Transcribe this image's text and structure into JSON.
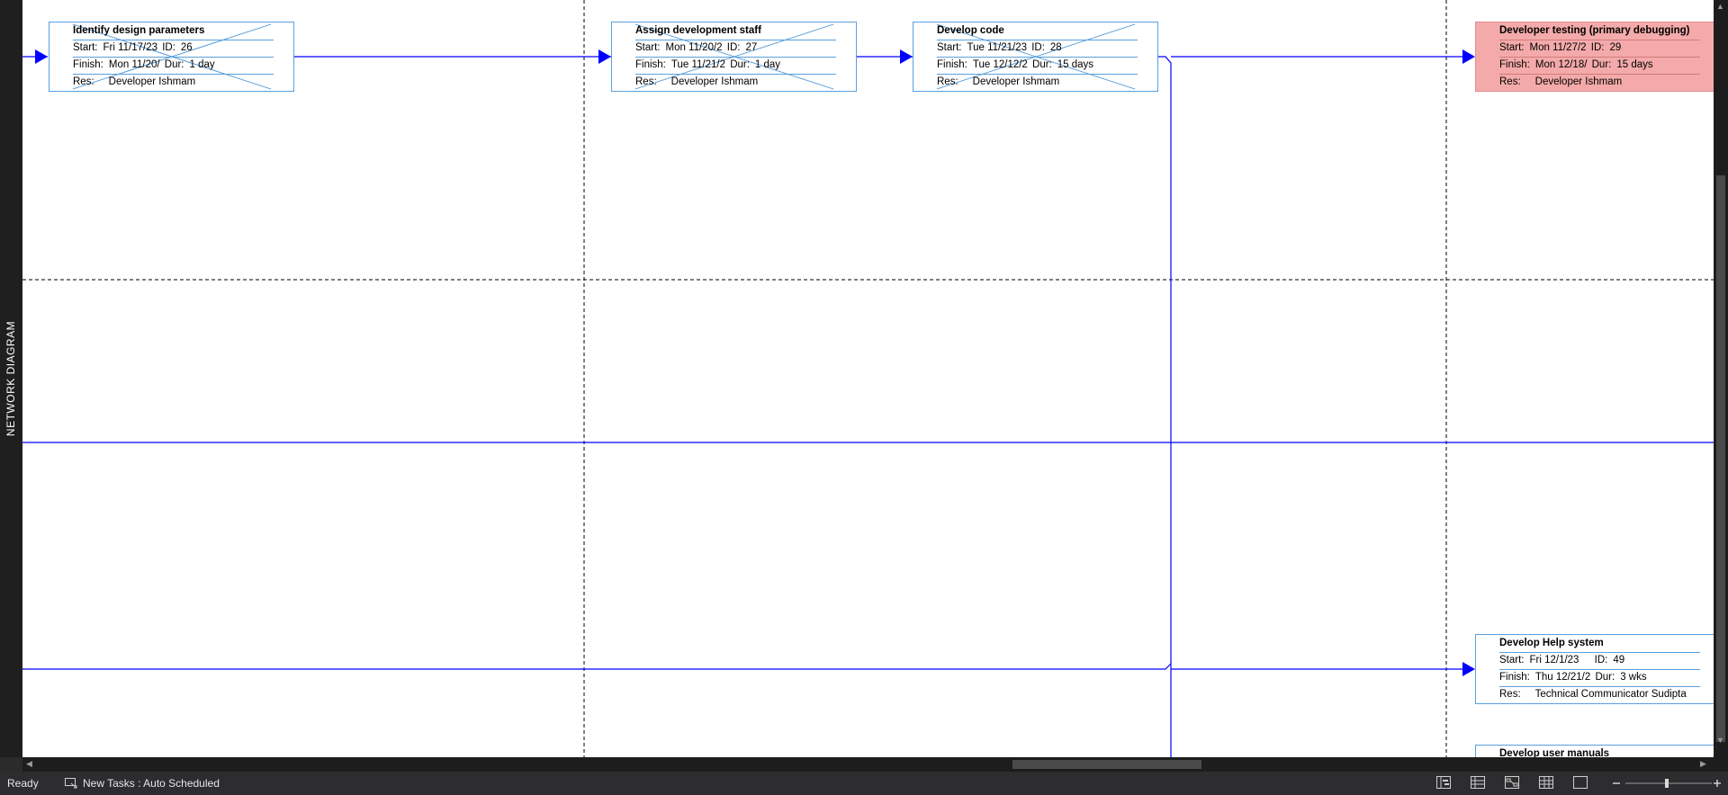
{
  "side_label": "NETWORK DIAGRAM",
  "labels": {
    "start": "Start:",
    "finish": "Finish:",
    "id": "ID:",
    "dur": "Dur:",
    "res": "Res:"
  },
  "tasks": [
    {
      "name": "Identify design parameters",
      "start": "Fri 11/17/23",
      "id": "26",
      "finish": "Mon 11/20/",
      "dur": "1 day",
      "res": "Developer Ishmam",
      "completed": true,
      "critical": false
    },
    {
      "name": "Assign development staff",
      "start": "Mon 11/20/2",
      "id": "27",
      "finish": "Tue 11/21/2",
      "dur": "1 day",
      "res": "Developer Ishmam",
      "completed": true,
      "critical": false
    },
    {
      "name": "Develop code",
      "start": "Tue 11/21/23",
      "id": "28",
      "finish": "Tue 12/12/2",
      "dur": "15 days",
      "res": "Developer Ishmam",
      "completed": true,
      "critical": false
    },
    {
      "name": "Developer testing (primary debugging)",
      "start": "Mon 11/27/2",
      "id": "29",
      "finish": "Mon 12/18/",
      "dur": "15 days",
      "res": "Developer Ishmam",
      "completed": false,
      "critical": true
    },
    {
      "name": "Develop Help system",
      "start": "Fri 12/1/23",
      "id": "49",
      "finish": "Thu 12/21/2",
      "dur": "3 wks",
      "res": "Technical Communicator Sudipta",
      "completed": false,
      "critical": false
    },
    {
      "name": "Develop user manuals",
      "completed": false,
      "critical": false
    }
  ],
  "status_bar": {
    "ready": "Ready",
    "new_tasks": "New Tasks : Auto Scheduled"
  },
  "colors": {
    "link": "#0000ff",
    "box_border": "#5aa0dc",
    "critical_fill": "#f4aaaa"
  }
}
